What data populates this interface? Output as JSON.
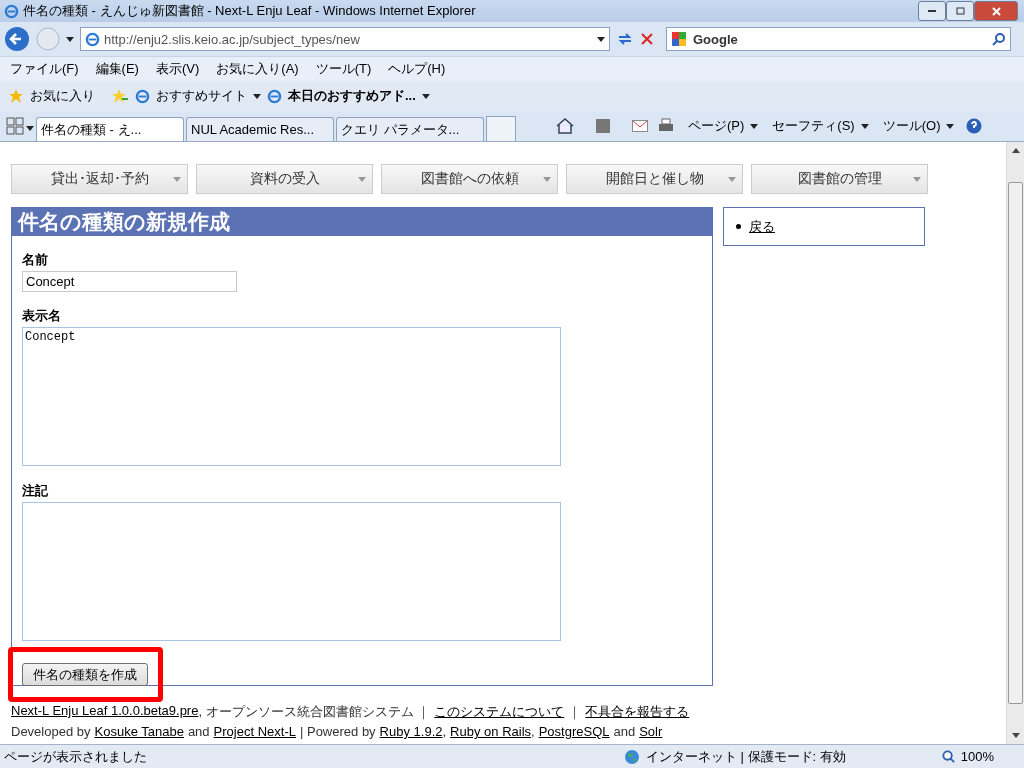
{
  "window": {
    "title": "件名の種類 - えんじゅ新図書館 - Next-L Enju Leaf - Windows Internet Explorer"
  },
  "address_bar": {
    "url": "http://enju2.slis.keio.ac.jp/subject_types/new"
  },
  "search": {
    "placeholder": "Google"
  },
  "menu": [
    "ファイル(F)",
    "編集(E)",
    "表示(V)",
    "お気に入り(A)",
    "ツール(T)",
    "ヘルプ(H)"
  ],
  "favorites_bar": {
    "favorites": "お気に入り",
    "items": [
      "おすすめサイト",
      "本日のおすすめアド..."
    ]
  },
  "tabs": [
    {
      "label": "件名の種類 - え...",
      "selected": true
    },
    {
      "label": "NUL Academic Res...",
      "selected": false
    },
    {
      "label": "クエリ パラメータ...",
      "selected": false
    }
  ],
  "command_bar": [
    "ページ(P)",
    "セーフティ(S)",
    "ツール(O)"
  ],
  "nav": [
    "貸出･返却･予約",
    "資料の受入",
    "図書館への依頼",
    "開館日と催し物",
    "図書館の管理"
  ],
  "panel": {
    "title": "件名の種類の新規作成",
    "fields": [
      {
        "kind": "input",
        "label": "名前",
        "value": "Concept"
      },
      {
        "kind": "textarea",
        "label": "表示名",
        "value": "Concept"
      },
      {
        "kind": "textarea",
        "label": "注記"
      }
    ],
    "submit": "件名の種類を作成",
    "highlighted": true
  },
  "sidebar": {
    "links": [
      "戻る"
    ]
  },
  "footer": [
    [
      {
        "text": "Next-L Enju Leaf 1.0.0.beta9.pre",
        "link": true
      },
      {
        "text": ", オープンソース統合図書館システム ｜",
        "link": false
      },
      {
        "text": "このシステムについて",
        "link": true
      },
      {
        "text": "｜",
        "link": false
      },
      {
        "text": "不具合を報告する",
        "link": true
      }
    ],
    [
      {
        "text": "Developed by",
        "link": false
      },
      {
        "text": "Kosuke Tanabe",
        "link": true
      },
      {
        "text": "and",
        "link": false
      },
      {
        "text": "Project Next-L",
        "link": true
      },
      {
        "text": "| Powered by",
        "link": false
      },
      {
        "text": "Ruby 1.9.2",
        "link": true
      },
      {
        "text": ",",
        "link": false
      },
      {
        "text": "Ruby on Rails",
        "link": true
      },
      {
        "text": ",",
        "link": false
      },
      {
        "text": "PostgreSQL",
        "link": true
      },
      {
        "text": "and",
        "link": false
      },
      {
        "text": "Solr",
        "link": true
      }
    ]
  ],
  "status_bar": {
    "text": "ページが表示されました",
    "zone": "インターネット | 保護モード: 有効",
    "zoom": "100%"
  }
}
